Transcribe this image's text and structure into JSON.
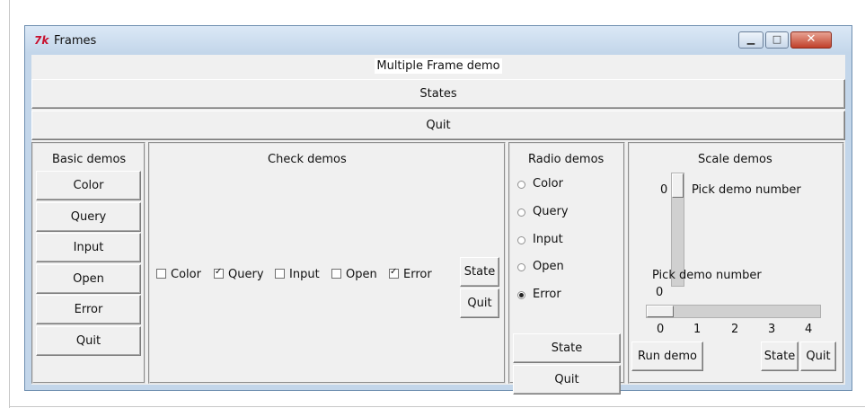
{
  "window": {
    "title": "Frames"
  },
  "top": {
    "heading": "Multiple Frame demo",
    "states_button": "States",
    "quit_button": "Quit"
  },
  "basic": {
    "title": "Basic demos",
    "buttons": [
      "Color",
      "Query",
      "Input",
      "Open",
      "Error",
      "Quit"
    ]
  },
  "check": {
    "title": "Check demos",
    "options": [
      {
        "label": "Color",
        "checked": false
      },
      {
        "label": "Query",
        "checked": true
      },
      {
        "label": "Input",
        "checked": false
      },
      {
        "label": "Open",
        "checked": false
      },
      {
        "label": "Error",
        "checked": true
      }
    ],
    "state_button": "State",
    "quit_button": "Quit"
  },
  "radio": {
    "title": "Radio demos",
    "options": [
      "Color",
      "Query",
      "Input",
      "Open",
      "Error"
    ],
    "selected": "Error",
    "state_button": "State",
    "quit_button": "Quit"
  },
  "scale": {
    "title": "Scale demos",
    "vertical_value": "0",
    "vertical_label": "Pick demo number",
    "horizontal_label": "Pick demo number",
    "horizontal_value": "0",
    "ticks": [
      "0",
      "1",
      "2",
      "3",
      "4"
    ],
    "run_button": "Run demo",
    "state_button": "State",
    "quit_button": "Quit"
  }
}
